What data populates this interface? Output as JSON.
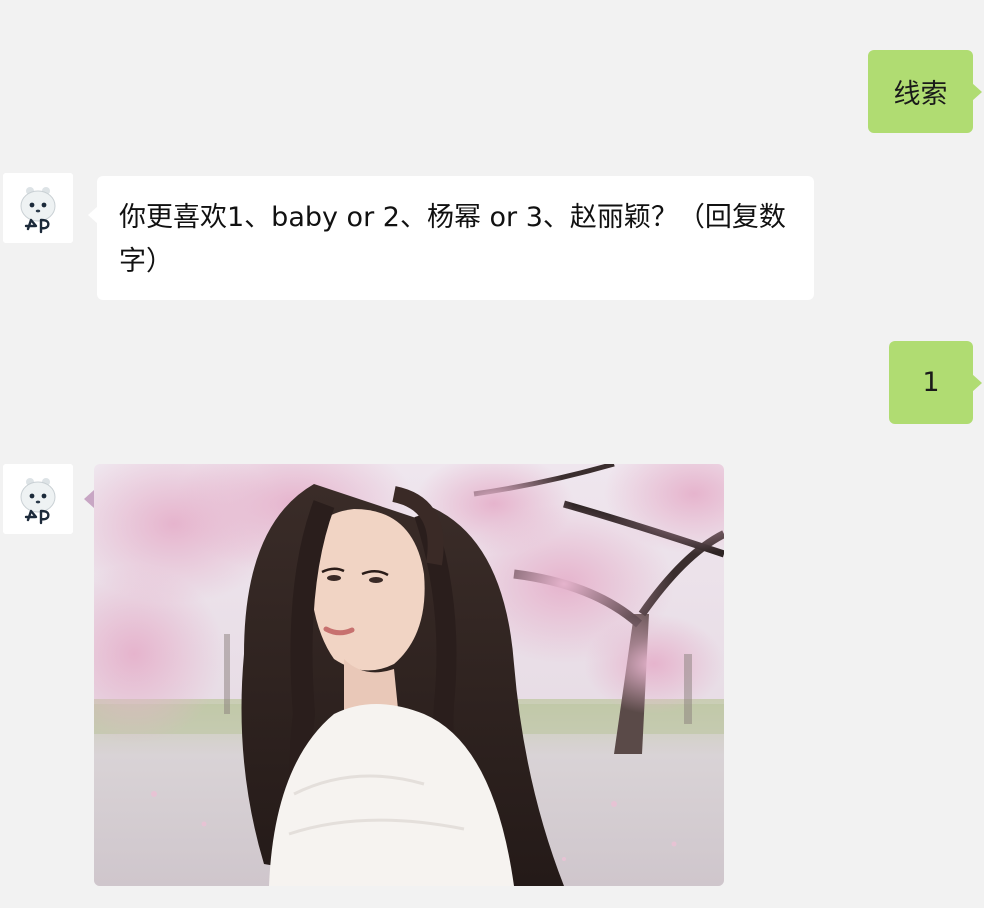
{
  "messages": [
    {
      "side": "outgoing",
      "type": "text",
      "text": "线索"
    },
    {
      "side": "incoming",
      "type": "text",
      "avatar_icon": "panda-avatar-icon",
      "text": "你更喜欢1、baby or 2、杨幂 or 3、赵丽颖？（回复数字）"
    },
    {
      "side": "outgoing",
      "type": "text",
      "text": "1"
    },
    {
      "side": "incoming",
      "type": "image",
      "avatar_icon": "panda-avatar-icon",
      "image_icon": "cherry-blossom-portrait-photo"
    }
  ],
  "colors": {
    "background": "#f2f2f2",
    "outgoing_bubble": "#b0dc72",
    "incoming_bubble": "#ffffff"
  }
}
